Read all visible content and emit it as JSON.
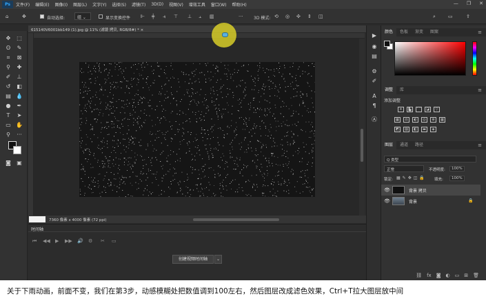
{
  "menubar": {
    "logo": "Ps",
    "items": [
      "文件(F)",
      "编辑(E)",
      "图像(I)",
      "图层(L)",
      "文字(Y)",
      "选择(S)",
      "滤镜(T)",
      "3D(D)",
      "视图(V)",
      "增效工具",
      "窗口(W)",
      "帮助(H)"
    ],
    "window_controls": [
      "—",
      "❐",
      "✕"
    ]
  },
  "optionsbar": {
    "auto_select_label": "自动选择:",
    "auto_select_target": "组",
    "show_transform_label": "显示变换控件",
    "three_d_mode_label": "3D 模式:"
  },
  "document": {
    "tab_title": "615140V6001bb149 (1).jpg @ 11% (滤镜 拷贝, RGB/8#) *  ×",
    "status_text": "7360 像素 x 4000 像素 (72 ppi)",
    "zoom": ""
  },
  "timeline": {
    "title": "时间轴",
    "create_button": "创建视频时间轴",
    "controls": [
      "⏮",
      "◀◀",
      "▶",
      "▶▶",
      "🔊",
      "⚙",
      "✂",
      "▭"
    ]
  },
  "panels": {
    "color_tabs": [
      "颜色",
      "色板",
      "渐变",
      "图案"
    ],
    "adjust_tabs": [
      "调整",
      "库"
    ],
    "adjust_label": "添加调整",
    "layers_tabs": [
      "图层",
      "通道",
      "路径"
    ],
    "layers_filter": "Q 类型",
    "blend_mode": "正常",
    "opacity_label": "不透明度:",
    "opacity_value": "100%",
    "lock_label": "锁定:",
    "fill_label": "填充:",
    "fill_value": "100%",
    "layers": [
      {
        "name": "背景 拷贝"
      },
      {
        "name": "背景"
      }
    ]
  },
  "caption": {
    "text": "关于下雨动画，前面不变，我们在第3步，动感模糊处把数值调到100左右，然后图层改成滤色效果，Ctrl+T拉大图层放中间"
  },
  "colors": {
    "accent": "#31a8ff",
    "cursor_highlight": "#d7cd28"
  }
}
